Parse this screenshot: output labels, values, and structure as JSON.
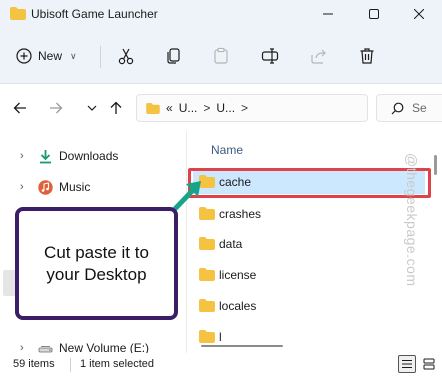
{
  "window": {
    "title": "Ubisoft Game Launcher"
  },
  "toolbar": {
    "new_label": "New",
    "icons": [
      "cut-icon",
      "copy-icon",
      "paste-icon",
      "rename-icon",
      "share-icon",
      "delete-icon"
    ]
  },
  "address": {
    "prefix": "«",
    "crumbs": [
      "U...",
      "U..."
    ],
    "separator": ">",
    "search_placeholder": "Se"
  },
  "navpane": {
    "items": [
      {
        "label": "Downloads",
        "icon": "download-icon"
      },
      {
        "label": "Music",
        "icon": "music-icon"
      },
      {
        "label": "New Volume (E:)",
        "icon": "drive-icon"
      }
    ]
  },
  "filelist": {
    "column_header": "Name",
    "files": [
      {
        "name": "cache",
        "selected": true
      },
      {
        "name": "crashes",
        "selected": false
      },
      {
        "name": "data",
        "selected": false
      },
      {
        "name": "license",
        "selected": false
      },
      {
        "name": "locales",
        "selected": false
      },
      {
        "name": "l",
        "selected": false
      }
    ]
  },
  "callout": {
    "text": "Cut paste it to your Desktop"
  },
  "watermark": "@thegeekpage.com",
  "status": {
    "item_count": "59 items",
    "selection": "1 item selected"
  },
  "colors": {
    "highlight_border": "#e0424a",
    "callout_border": "#3b1e66",
    "arrow": "#17a589",
    "selection_bg": "#cce8ff",
    "folder": "#f5c342"
  }
}
